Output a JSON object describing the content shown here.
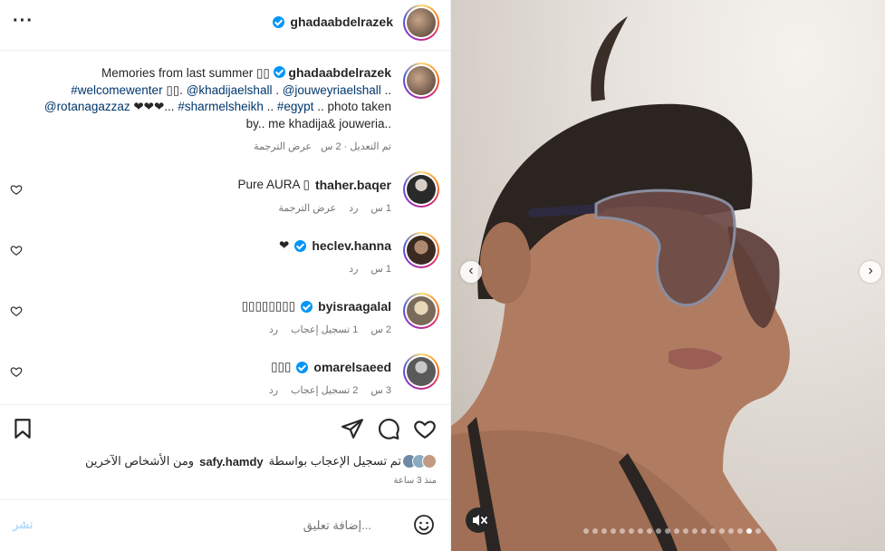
{
  "header": {
    "username": "ghadaabdelrazek",
    "more": "···"
  },
  "caption": {
    "username": "ghadaabdelrazek",
    "line1": "Memories from last summer ",
    "boxes1": "▯▯",
    "tag_welcome": "#welcomewenter",
    "boxes2": " ▯▯.",
    "mention1": "@khadijaelshall",
    "sep1": " . ",
    "mention2": "@jouweyriaelshall",
    "sep2": " ..",
    "mention3": "@rotanagazzaz",
    "hearts": " ❤❤❤... ",
    "tag_sharm": "#sharmelsheikh",
    "sep3": " .. ",
    "tag_egypt": "#egypt",
    "tail": " .. photo taken by.. me khadija& jouweria..",
    "meta": "تم التعديل · 2 س",
    "translate": "عرض الترجمة"
  },
  "comments": [
    {
      "text": "Pure AURA ▯",
      "username": "thaher.baqer",
      "verified": false,
      "time": "1 س",
      "reply": "رد",
      "translate": "عرض الترجمة",
      "likes": ""
    },
    {
      "text": "❤",
      "username": "heclev.hanna",
      "verified": true,
      "time": "1 س",
      "reply": "رد",
      "translate": "",
      "likes": ""
    },
    {
      "text": "▯▯▯▯▯▯▯▯",
      "username": "byisraagalal",
      "verified": true,
      "time": "2 س",
      "reply": "رد",
      "translate": "",
      "likes": "1 تسجيل إعجاب"
    },
    {
      "text": "▯▯▯",
      "username": "omarelsaeed",
      "verified": true,
      "time": "3 س",
      "reply": "رد",
      "translate": "",
      "likes": "2 تسجيل إعجاب"
    }
  ],
  "likes": {
    "prefix": "تم تسجيل الإعجاب بواسطة ",
    "user": "safy.hamdy",
    "suffix": " ومن الأشخاص الآخرين",
    "time": "منذ 3 ساعة"
  },
  "comment_box": {
    "placeholder": "إضافة تعليق...",
    "post_label": "نشر"
  },
  "carousel": {
    "count": 20,
    "active": 18
  },
  "colors": {
    "link": "#00376b",
    "verified": "#0095f6",
    "muted": "#737373"
  }
}
